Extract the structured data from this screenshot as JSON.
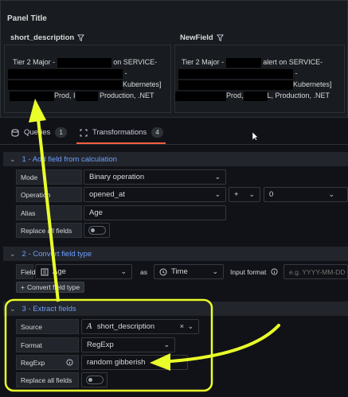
{
  "panel": {
    "title": "Panel Title",
    "columns": [
      {
        "header": "short_description",
        "line1": "Tier 2 Major -",
        "line1b": "on SERVICE-",
        "line2": "-",
        "line3": "Kubernetes]",
        "line4a": "Prod, I",
        "line4b": "Production, .NET"
      },
      {
        "header": "NewField",
        "line1": "Tier 2 Major -",
        "line1b": "alert on SERVICE-",
        "line2": "-",
        "line3": "Kubernetes]",
        "line4a": "Prod,",
        "line4b": "L, Production, .NET"
      }
    ]
  },
  "tabs": [
    {
      "label": "Queries",
      "count": "1",
      "icon": "database-icon"
    },
    {
      "label": "Transformations",
      "count": "4",
      "icon": "transform-icon"
    }
  ],
  "transformations": [
    {
      "title": "1 - Add field from calculation",
      "mode": {
        "label": "Mode",
        "value": "Binary operation"
      },
      "operation": {
        "label": "Operation",
        "left": "opened_at",
        "operator": "+",
        "right": "0"
      },
      "alias": {
        "label": "Alias",
        "value": "Age"
      },
      "replace": {
        "label": "Replace all fields"
      }
    },
    {
      "title": "2 - Convert field type",
      "field": {
        "label": "Field",
        "value": "Age",
        "as": "as",
        "type": "Time",
        "input_format_label": "Input format",
        "input_format_placeholder": "e.g. YYYY-MM-DD"
      },
      "button": "Convert field type"
    },
    {
      "title": "3 - Extract fields",
      "source": {
        "label": "Source",
        "value": "short_description"
      },
      "format": {
        "label": "Format",
        "value": "RegExp"
      },
      "regexp": {
        "label": "RegExp",
        "value": "random gibberish"
      },
      "replace": {
        "label": "Replace all fields"
      }
    }
  ],
  "colors": {
    "accent_link": "#6e9fff",
    "tab_active": "#f55f3e",
    "annotation": "#eaff2a"
  }
}
